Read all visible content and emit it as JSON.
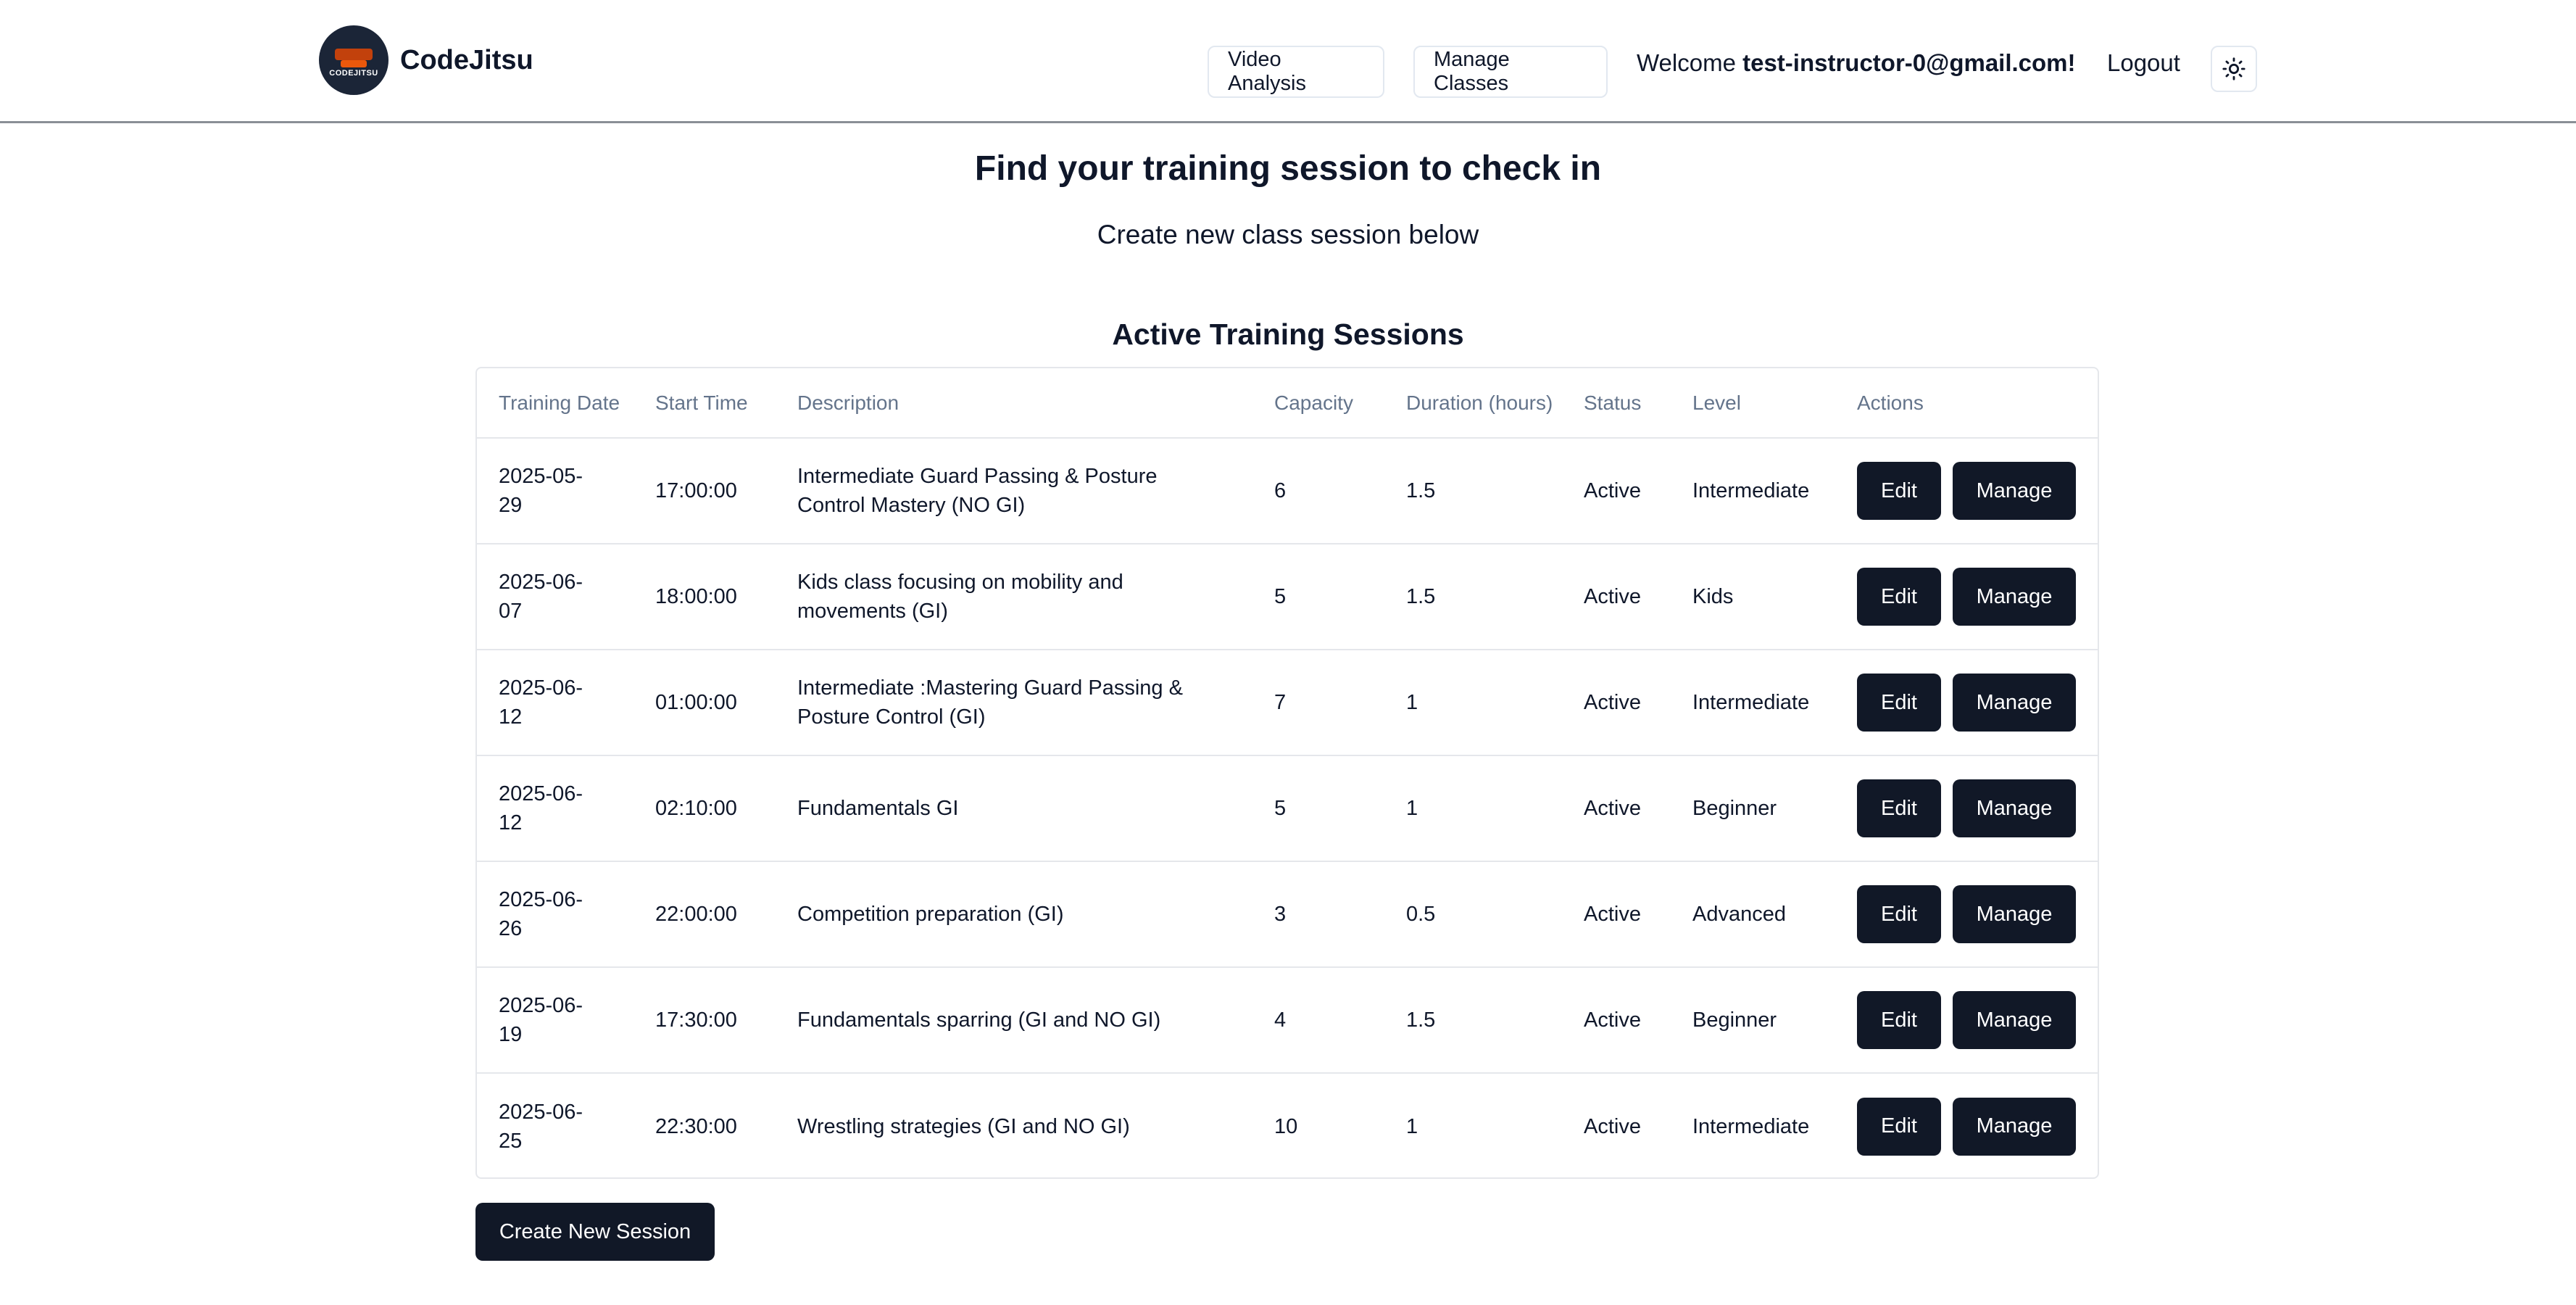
{
  "header": {
    "brand_name": "CodeJitsu",
    "logo_text": "CODEJITSU",
    "nav": {
      "video_analysis": "Video Analysis",
      "manage_classes": "Manage Classes"
    },
    "welcome_prefix": "Welcome",
    "user_email": "test-instructor-0@gmail.com!",
    "logout": "Logout",
    "theme_icon": "sun-icon"
  },
  "main": {
    "title": "Find your training session to check in",
    "subtitle": "Create new class session below",
    "section_title": "Active Training Sessions"
  },
  "table": {
    "columns": [
      "Training Date",
      "Start Time",
      "Description",
      "Capacity",
      "Duration (hours)",
      "Status",
      "Level",
      "Actions"
    ],
    "edit_label": "Edit",
    "manage_label": "Manage",
    "rows": [
      {
        "date": "2025-05-29",
        "start": "17:00:00",
        "description": "Intermediate Guard Passing & Posture Control Mastery (NO GI)",
        "capacity": "6",
        "duration": "1.5",
        "status": "Active",
        "level": "Intermediate"
      },
      {
        "date": "2025-06-07",
        "start": "18:00:00",
        "description": "Kids class focusing on mobility and movements (GI)",
        "capacity": "5",
        "duration": "1.5",
        "status": "Active",
        "level": "Kids"
      },
      {
        "date": "2025-06-12",
        "start": "01:00:00",
        "description": "Intermediate :Mastering Guard Passing & Posture Control (GI)",
        "capacity": "7",
        "duration": "1",
        "status": "Active",
        "level": "Intermediate"
      },
      {
        "date": "2025-06-12",
        "start": "02:10:00",
        "description": "Fundamentals GI",
        "capacity": "5",
        "duration": "1",
        "status": "Active",
        "level": "Beginner"
      },
      {
        "date": "2025-06-26",
        "start": "22:00:00",
        "description": "Competition preparation (GI)",
        "capacity": "3",
        "duration": "0.5",
        "status": "Active",
        "level": "Advanced"
      },
      {
        "date": "2025-06-19",
        "start": "17:30:00",
        "description": "Fundamentals sparring (GI and NO GI)",
        "capacity": "4",
        "duration": "1.5",
        "status": "Active",
        "level": "Beginner"
      },
      {
        "date": "2025-06-25",
        "start": "22:30:00",
        "description": "Wrestling strategies (GI and NO GI)",
        "capacity": "10",
        "duration": "1",
        "status": "Active",
        "level": "Intermediate"
      }
    ]
  },
  "create_button": "Create New Session",
  "colors": {
    "primary_button": "#111827",
    "header_border": "#8a8f96",
    "muted_text": "#64748b"
  }
}
